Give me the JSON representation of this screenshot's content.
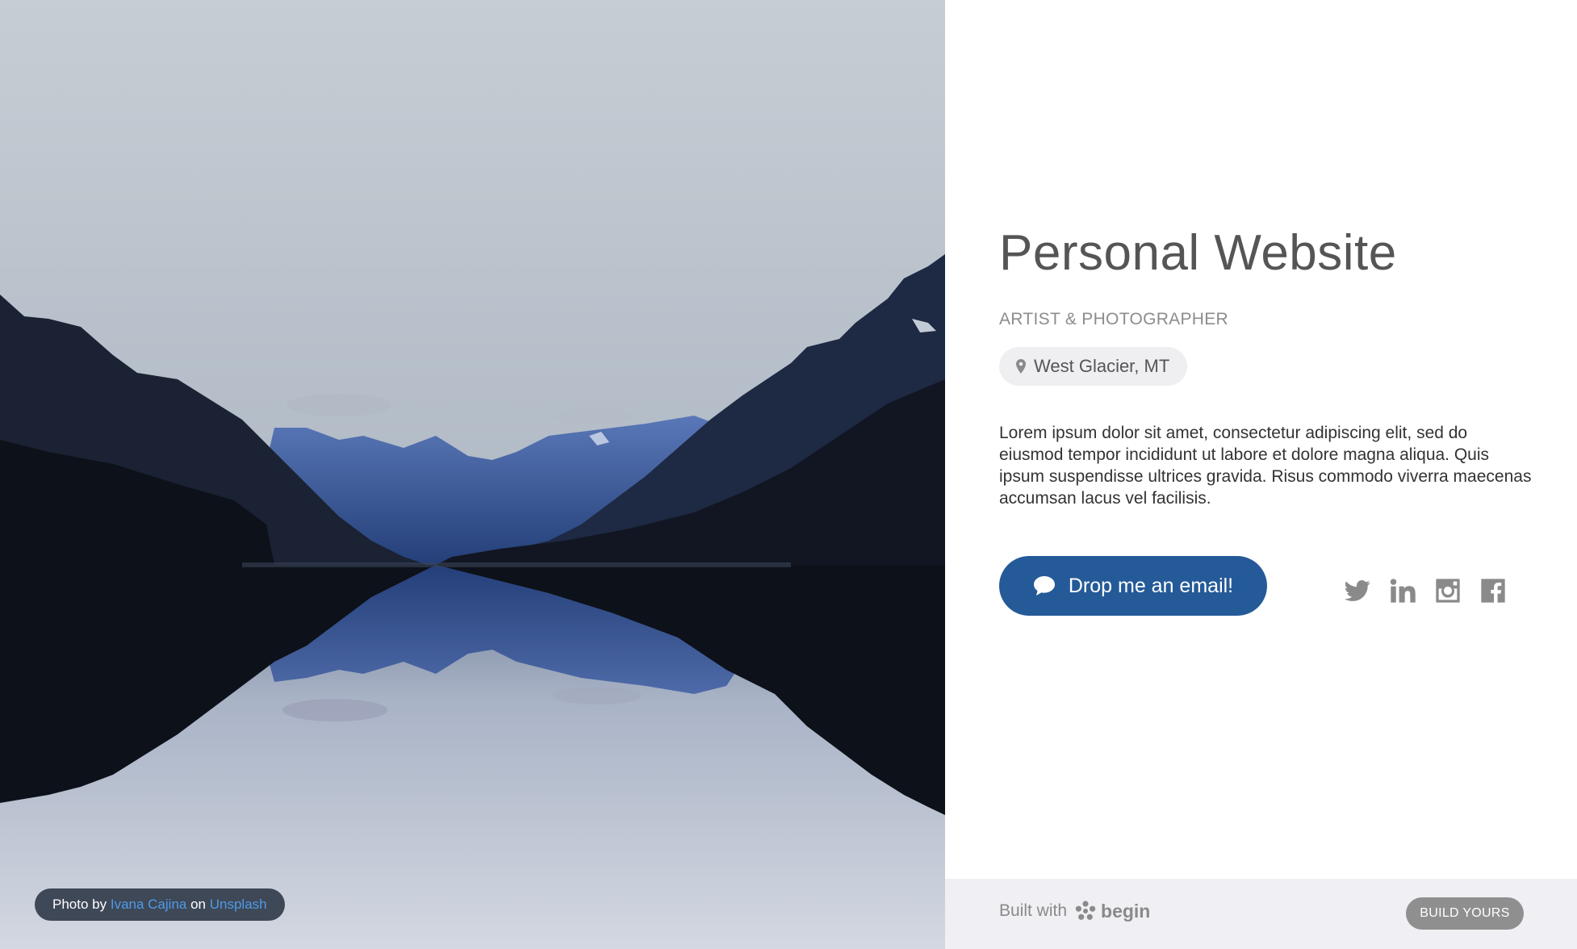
{
  "hero": {
    "photo_credit": {
      "prefix": "Photo by",
      "author": "Ivana Cajina",
      "connector": "on",
      "source": "Unsplash"
    }
  },
  "profile": {
    "title": "Personal Website",
    "subtitle": "ARTIST & PHOTOGRAPHER",
    "location": "West Glacier, MT",
    "bio": "Lorem ipsum dolor sit amet, consectetur adipiscing elit, sed do eiusmod tempor incididunt ut labore et dolore magna aliqua. Quis ipsum suspendisse ultrices gravida. Risus commodo viverra maecenas accumsan lacus vel facilisis.",
    "cta_label": "Drop me an email!"
  },
  "social": {
    "icons": [
      "twitter-icon",
      "linkedin-icon",
      "instagram-icon",
      "facebook-icon"
    ]
  },
  "footer": {
    "built_with": "Built with",
    "brand": "begin",
    "build_button": "BUILD YOURS"
  },
  "colors": {
    "accent": "#255a98",
    "link": "#4f9be8",
    "icon_gray": "#8a8a8a",
    "footer_bg": "#f0eff3"
  }
}
